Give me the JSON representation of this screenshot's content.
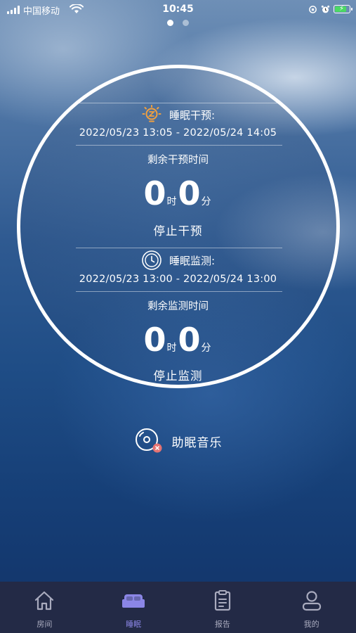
{
  "status_bar": {
    "carrier": "中国移动",
    "time": "10:45",
    "battery_level": 0.85,
    "battery_color": "#4cd964"
  },
  "pager": {
    "count": 2,
    "active_index": 0
  },
  "intervention": {
    "icon": "sleep-lamp-icon",
    "title": "睡眠干预:",
    "date_range": "2022/05/23 13:05 - 2022/05/24 14:05",
    "remaining_label": "剩余干预时间",
    "hours": "0",
    "hours_unit": "时",
    "minutes": "0",
    "minutes_unit": "分",
    "action_label": "停止干预"
  },
  "monitoring": {
    "icon": "clock-icon",
    "title": "睡眠监测:",
    "date_range": "2022/05/23 13:00 - 2022/05/24 13:00",
    "remaining_label": "剩余监测时间",
    "hours": "0",
    "hours_unit": "时",
    "minutes": "0",
    "minutes_unit": "分",
    "action_label": "停止监测"
  },
  "music": {
    "icon": "music-disc-icon",
    "label": "助眠音乐"
  },
  "tabs": [
    {
      "label": "房间",
      "icon": "home-icon",
      "active": false
    },
    {
      "label": "睡眠",
      "icon": "bed-icon",
      "active": true
    },
    {
      "label": "报告",
      "icon": "clipboard-icon",
      "active": false
    },
    {
      "label": "我的",
      "icon": "user-icon",
      "active": false
    }
  ],
  "colors": {
    "accent": "#8b86e6",
    "tab_bar_bg": "#232a46",
    "tab_inactive": "#a9abbe",
    "lamp_orange": "#f0a040",
    "badge_red": "#e57373"
  }
}
